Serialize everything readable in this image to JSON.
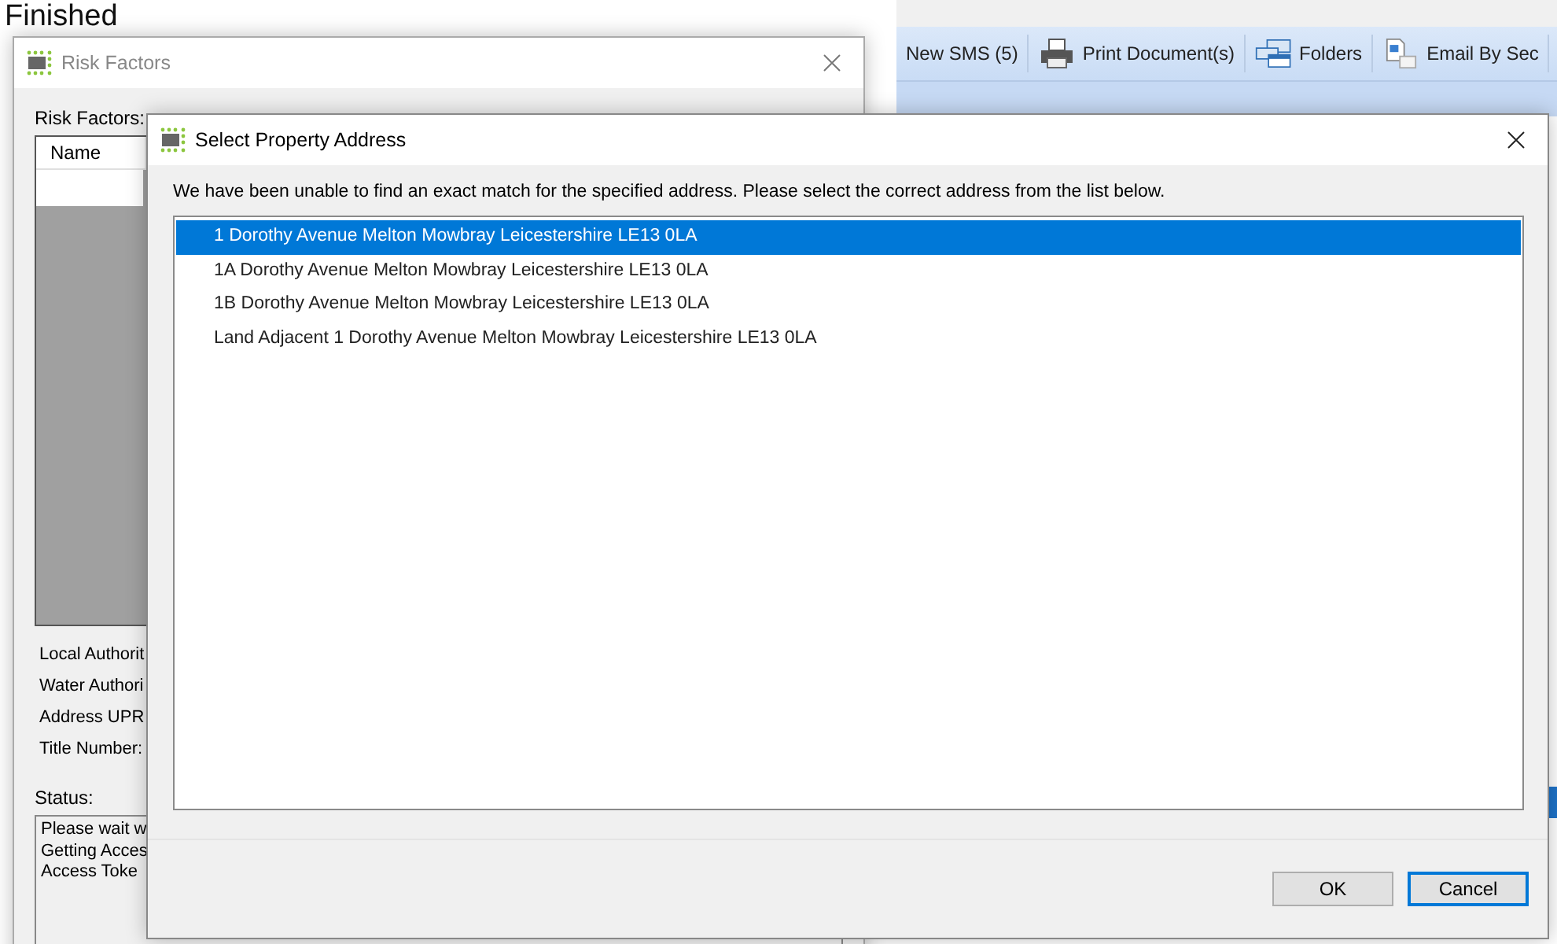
{
  "background": {
    "heading": "Finished",
    "toolbar": [
      {
        "label": "New SMS (5)"
      },
      {
        "label": "Print Document(s)"
      },
      {
        "label": "Folders"
      },
      {
        "label": "Email By Sec"
      }
    ]
  },
  "risk_window": {
    "title": "Risk Factors",
    "list_label": "Risk Factors:",
    "columns": [
      "Name"
    ],
    "fields": [
      "Local Authorit",
      "Water Authori",
      "Address UPR",
      "Title Number:"
    ],
    "status_label": "Status:",
    "status_lines": [
      "Please wait w",
      "Getting Acces",
      "Access Toke"
    ]
  },
  "dialog": {
    "title": "Select Property Address",
    "message": "We have been unable to find an exact match for the specified address. Please select the correct address from the list below.",
    "addresses": [
      {
        "text": "1 Dorothy Avenue Melton Mowbray Leicestershire LE13 0LA",
        "selected": true
      },
      {
        "text": "1A Dorothy Avenue Melton Mowbray Leicestershire LE13 0LA",
        "selected": false
      },
      {
        "text": "1B Dorothy Avenue Melton Mowbray Leicestershire LE13 0LA",
        "selected": false
      },
      {
        "text": "Land Adjacent 1 Dorothy Avenue Melton Mowbray Leicestershire LE13 0LA",
        "selected": false
      }
    ],
    "buttons": [
      {
        "label": "OK",
        "focused": false
      },
      {
        "label": "Cancel",
        "focused": true
      }
    ]
  }
}
